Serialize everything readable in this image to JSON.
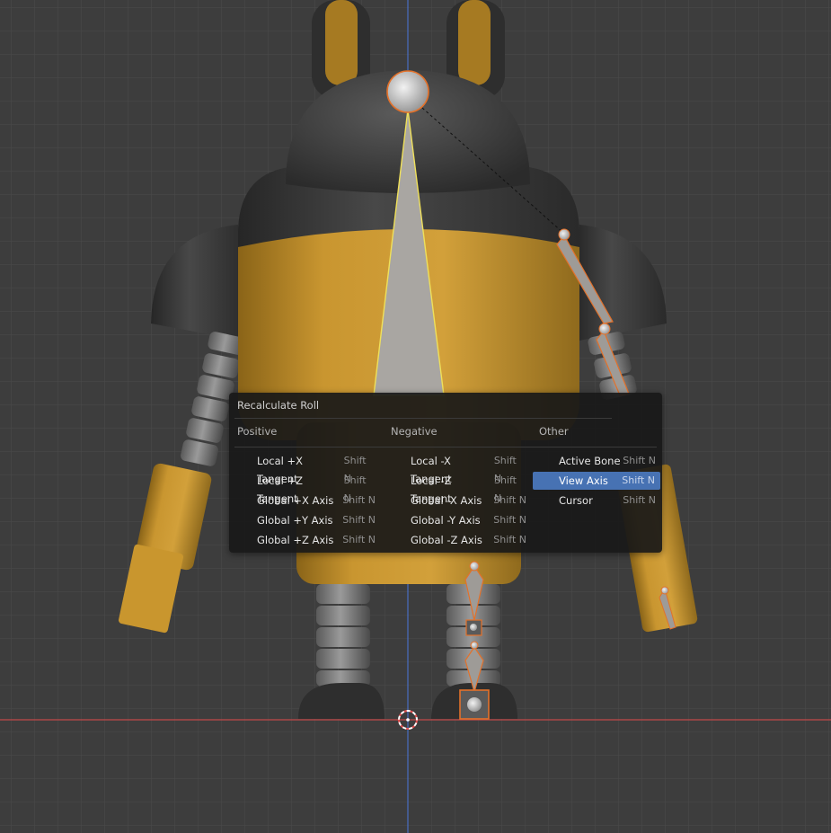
{
  "menu": {
    "title": "Recalculate Roll",
    "columns": [
      {
        "heading": "Positive",
        "items": [
          {
            "label": "Local +X Tangent",
            "shortcut": "Shift N"
          },
          {
            "label": "Local +Z Tangent",
            "shortcut": "Shift N"
          },
          {
            "label": "Global +X Axis",
            "shortcut": "Shift N"
          },
          {
            "label": "Global +Y Axis",
            "shortcut": "Shift N"
          },
          {
            "label": "Global +Z Axis",
            "shortcut": "Shift N"
          }
        ]
      },
      {
        "heading": "Negative",
        "items": [
          {
            "label": "Local -X Tangent",
            "shortcut": "Shift N"
          },
          {
            "label": "Local -Z Tangent",
            "shortcut": "Shift N"
          },
          {
            "label": "Global -X Axis",
            "shortcut": "Shift N"
          },
          {
            "label": "Global -Y Axis",
            "shortcut": "Shift N"
          },
          {
            "label": "Global -Z Axis",
            "shortcut": "Shift N"
          }
        ]
      },
      {
        "heading": "Other",
        "items": [
          {
            "label": "Active Bone",
            "shortcut": "Shift N"
          },
          {
            "label": "View Axis",
            "shortcut": "Shift N",
            "highlighted": true
          },
          {
            "label": "Cursor",
            "shortcut": "Shift N"
          }
        ]
      }
    ]
  },
  "colors": {
    "viewport_bg": "#3d3d3d",
    "grid": "#4a4a4a",
    "axis_x": "#c24a4a",
    "axis_z": "#4a6fc2",
    "body_yellow": "#c9962e",
    "body_dark": "#3a3a3a",
    "bone": "#a9a6a2",
    "selection": "#e3712a",
    "menu_highlight": "#4772b3"
  }
}
